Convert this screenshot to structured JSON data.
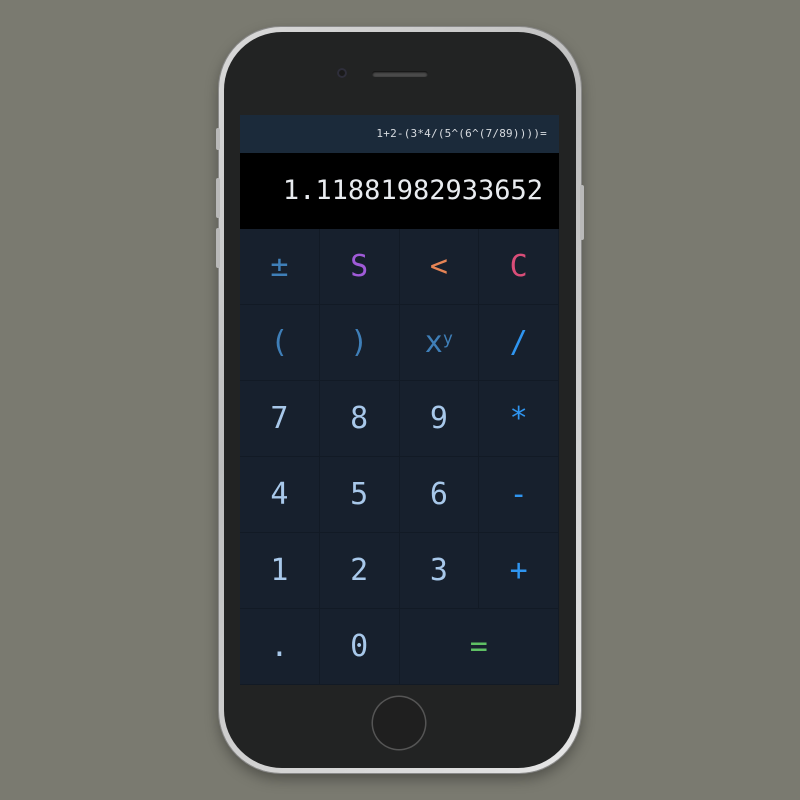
{
  "display": {
    "expression": "1+2-(3*4/(5^(6^(7/89))))=",
    "result": "1.11881982933652"
  },
  "keypad": {
    "row1": {
      "plus_minus": "±",
      "s": "S",
      "backspace": "<",
      "clear": "C"
    },
    "row2": {
      "open_paren": "(",
      "close_paren": ")",
      "power_base": "x",
      "power_exp": "y",
      "divide": "/"
    },
    "row3": {
      "seven": "7",
      "eight": "8",
      "nine": "9",
      "multiply": "*"
    },
    "row4": {
      "four": "4",
      "five": "5",
      "six": "6",
      "minus": "-"
    },
    "row5": {
      "one": "1",
      "two": "2",
      "three": "3",
      "plus": "+"
    },
    "row6": {
      "decimal": ".",
      "zero": "0",
      "equals": "="
    }
  },
  "colors": {
    "background": "#7a7a70",
    "screen": "#17202d",
    "display_bg": "#000000",
    "expression_bg": "#1b2a3a",
    "digit": "#a8c8ea",
    "operator": "#2f95f0",
    "s_key": "#a05bd8",
    "backspace_key": "#e68455",
    "clear_key": "#d94d78",
    "equals_key": "#5fc064"
  },
  "device": {
    "type": "smartphone",
    "icons": [
      "camera-icon",
      "speaker-icon",
      "home-button"
    ]
  }
}
